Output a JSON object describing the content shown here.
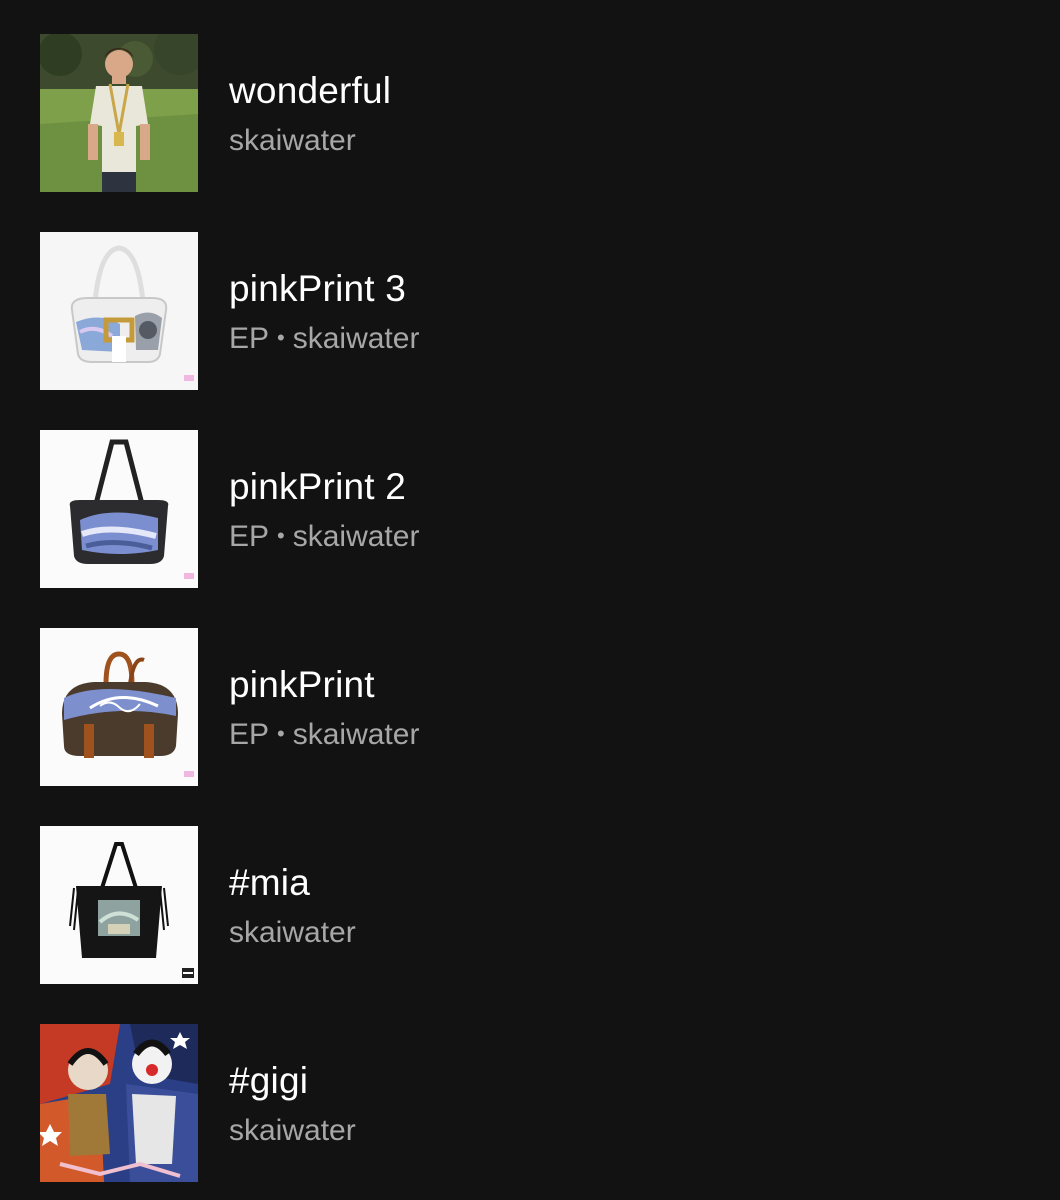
{
  "items": [
    {
      "title": "wonderful",
      "type": "",
      "artist": "skaiwater",
      "cover_icon": "boy-in-field-cover"
    },
    {
      "title": "pinkPrint 3",
      "type": "EP",
      "separator": "•",
      "artist": "skaiwater",
      "cover_icon": "white-handbag-cover"
    },
    {
      "title": "pinkPrint 2",
      "type": "EP",
      "separator": "•",
      "artist": "skaiwater",
      "cover_icon": "black-handbag-cover"
    },
    {
      "title": "pinkPrint",
      "type": "EP",
      "separator": "•",
      "artist": "skaiwater",
      "cover_icon": "duffel-bag-cover"
    },
    {
      "title": "#mia",
      "type": "",
      "artist": "skaiwater",
      "cover_icon": "fringe-bag-cover"
    },
    {
      "title": "#gigi",
      "type": "",
      "artist": "skaiwater",
      "cover_icon": "painting-cover"
    }
  ],
  "colors": {
    "background": "#121212",
    "title": "#ffffff",
    "subtitle": "#a7a7a7"
  }
}
